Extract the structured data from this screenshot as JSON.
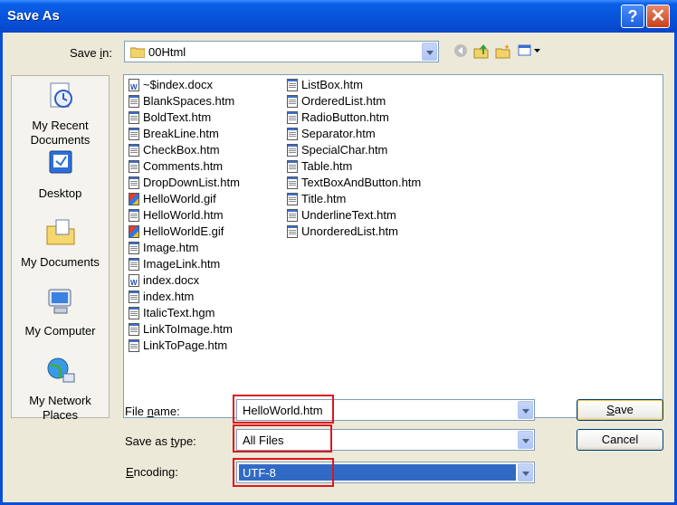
{
  "window": {
    "title": "Save As",
    "help_glyph": "?",
    "close_glyph": "✕"
  },
  "toolbar": {
    "save_in_label_pre": "Save ",
    "save_in_label_ul": "i",
    "save_in_label_post": "n:",
    "save_in_value": "00Html",
    "icons": [
      "back-icon",
      "up-folder-icon",
      "new-folder-icon",
      "views-menu-icon"
    ]
  },
  "places": [
    {
      "label": "My Recent Documents",
      "icon": "recent-documents-icon"
    },
    {
      "label": "Desktop",
      "icon": "desktop-icon"
    },
    {
      "label": "My Documents",
      "icon": "my-documents-icon"
    },
    {
      "label": "My Computer",
      "icon": "my-computer-icon"
    },
    {
      "label": "My Network Places",
      "icon": "network-places-icon"
    }
  ],
  "files_col1": [
    {
      "name": "~$index.docx",
      "type": "doc"
    },
    {
      "name": "BlankSpaces.htm",
      "type": "htm"
    },
    {
      "name": "BoldText.htm",
      "type": "htm"
    },
    {
      "name": "BreakLine.htm",
      "type": "htm"
    },
    {
      "name": "CheckBox.htm",
      "type": "htm"
    },
    {
      "name": "Comments.htm",
      "type": "htm"
    },
    {
      "name": "DropDownList.htm",
      "type": "htm"
    },
    {
      "name": "HelloWorld.gif",
      "type": "gif"
    },
    {
      "name": "HelloWorld.htm",
      "type": "htm"
    },
    {
      "name": "HelloWorldE.gif",
      "type": "gif"
    },
    {
      "name": "Image.htm",
      "type": "htm"
    },
    {
      "name": "ImageLink.htm",
      "type": "htm"
    },
    {
      "name": "index.docx",
      "type": "doc"
    },
    {
      "name": "index.htm",
      "type": "htm"
    },
    {
      "name": "ItalicText.hgm",
      "type": "htm"
    },
    {
      "name": "LinkToImage.htm",
      "type": "htm"
    },
    {
      "name": "LinkToPage.htm",
      "type": "htm"
    }
  ],
  "files_col2": [
    {
      "name": "ListBox.htm",
      "type": "htm"
    },
    {
      "name": "OrderedList.htm",
      "type": "htm"
    },
    {
      "name": "RadioButton.htm",
      "type": "htm"
    },
    {
      "name": "Separator.htm",
      "type": "htm"
    },
    {
      "name": "SpecialChar.htm",
      "type": "htm"
    },
    {
      "name": "Table.htm",
      "type": "htm"
    },
    {
      "name": "TextBoxAndButton.htm",
      "type": "htm"
    },
    {
      "name": "Title.htm",
      "type": "htm"
    },
    {
      "name": "UnderlineText.htm",
      "type": "htm"
    },
    {
      "name": "UnorderedList.htm",
      "type": "htm"
    }
  ],
  "form": {
    "file_name_label_pre": "File ",
    "file_name_label_ul": "n",
    "file_name_label_post": "ame:",
    "file_name_value": "HelloWorld.htm",
    "save_type_label_pre": "Save as ",
    "save_type_label_ul": "t",
    "save_type_label_post": "ype:",
    "save_type_value": "All Files",
    "encoding_label_ul": "E",
    "encoding_label_post": "ncoding:",
    "encoding_value": "UTF-8"
  },
  "buttons": {
    "save_ul": "S",
    "save_post": "ave",
    "cancel": "Cancel"
  },
  "colors": {
    "highlight": "#e0141e",
    "selection": "#316ac5",
    "titlebar": "#0a5fe8"
  }
}
